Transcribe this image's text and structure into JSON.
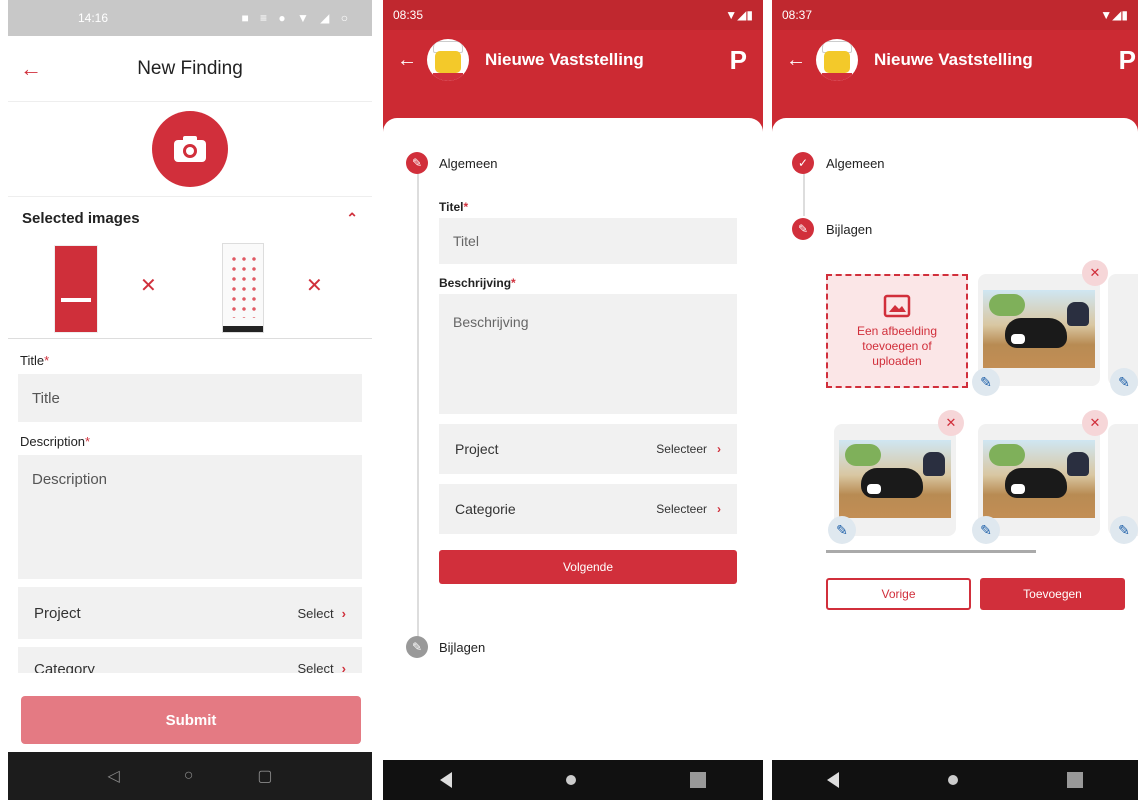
{
  "screen1": {
    "status": {
      "time": "14:16",
      "icons": "■ ≡ ● ▼ ◢ ○"
    },
    "header": {
      "title": "New Finding"
    },
    "selected_images": {
      "label": "Selected images"
    },
    "fields": {
      "title_label": "Title",
      "title_placeholder": "Title",
      "description_label": "Description",
      "description_placeholder": "Description",
      "project_label": "Project",
      "project_value": "Select",
      "category_label": "Category",
      "category_value": "Select"
    },
    "required_mark": "*",
    "submit_label": "Submit",
    "nav": {
      "back": "◁",
      "home": "○",
      "recent": "▢"
    }
  },
  "screen2": {
    "status": {
      "time": "08:35",
      "icons": "▼◢▮"
    },
    "header": {
      "title": "Nieuwe Vaststelling",
      "logo": "P"
    },
    "steps": {
      "step1": "Algemeen",
      "step2": "Bijlagen"
    },
    "fields": {
      "title_label": "Titel",
      "title_placeholder": "Titel",
      "description_label": "Beschrijving",
      "description_placeholder": "Beschrijving",
      "project_label": "Project",
      "project_value": "Selecteer",
      "category_label": "Categorie",
      "category_value": "Selecteer"
    },
    "next_label": "Volgende"
  },
  "screen3": {
    "status": {
      "time": "08:37",
      "icons": "▼◢▮"
    },
    "header": {
      "title": "Nieuwe Vaststelling",
      "logo": "P"
    },
    "steps": {
      "step1": "Algemeen",
      "step2": "Bijlagen"
    },
    "upload_text": "Een afbeelding toevoegen of uploaden",
    "prev_label": "Vorige",
    "add_label": "Toevoegen"
  },
  "colors": {
    "accent": "#d12f3b",
    "header": "#cc2a33",
    "submit_disabled": "#e47a83",
    "field_bg": "#f1f1f1"
  },
  "icons": [
    "back-arrow-icon",
    "camera-icon",
    "chevron-up-icon",
    "close-icon",
    "chevron-right-icon",
    "pencil-icon",
    "check-icon",
    "image-icon",
    "logo-icon"
  ]
}
